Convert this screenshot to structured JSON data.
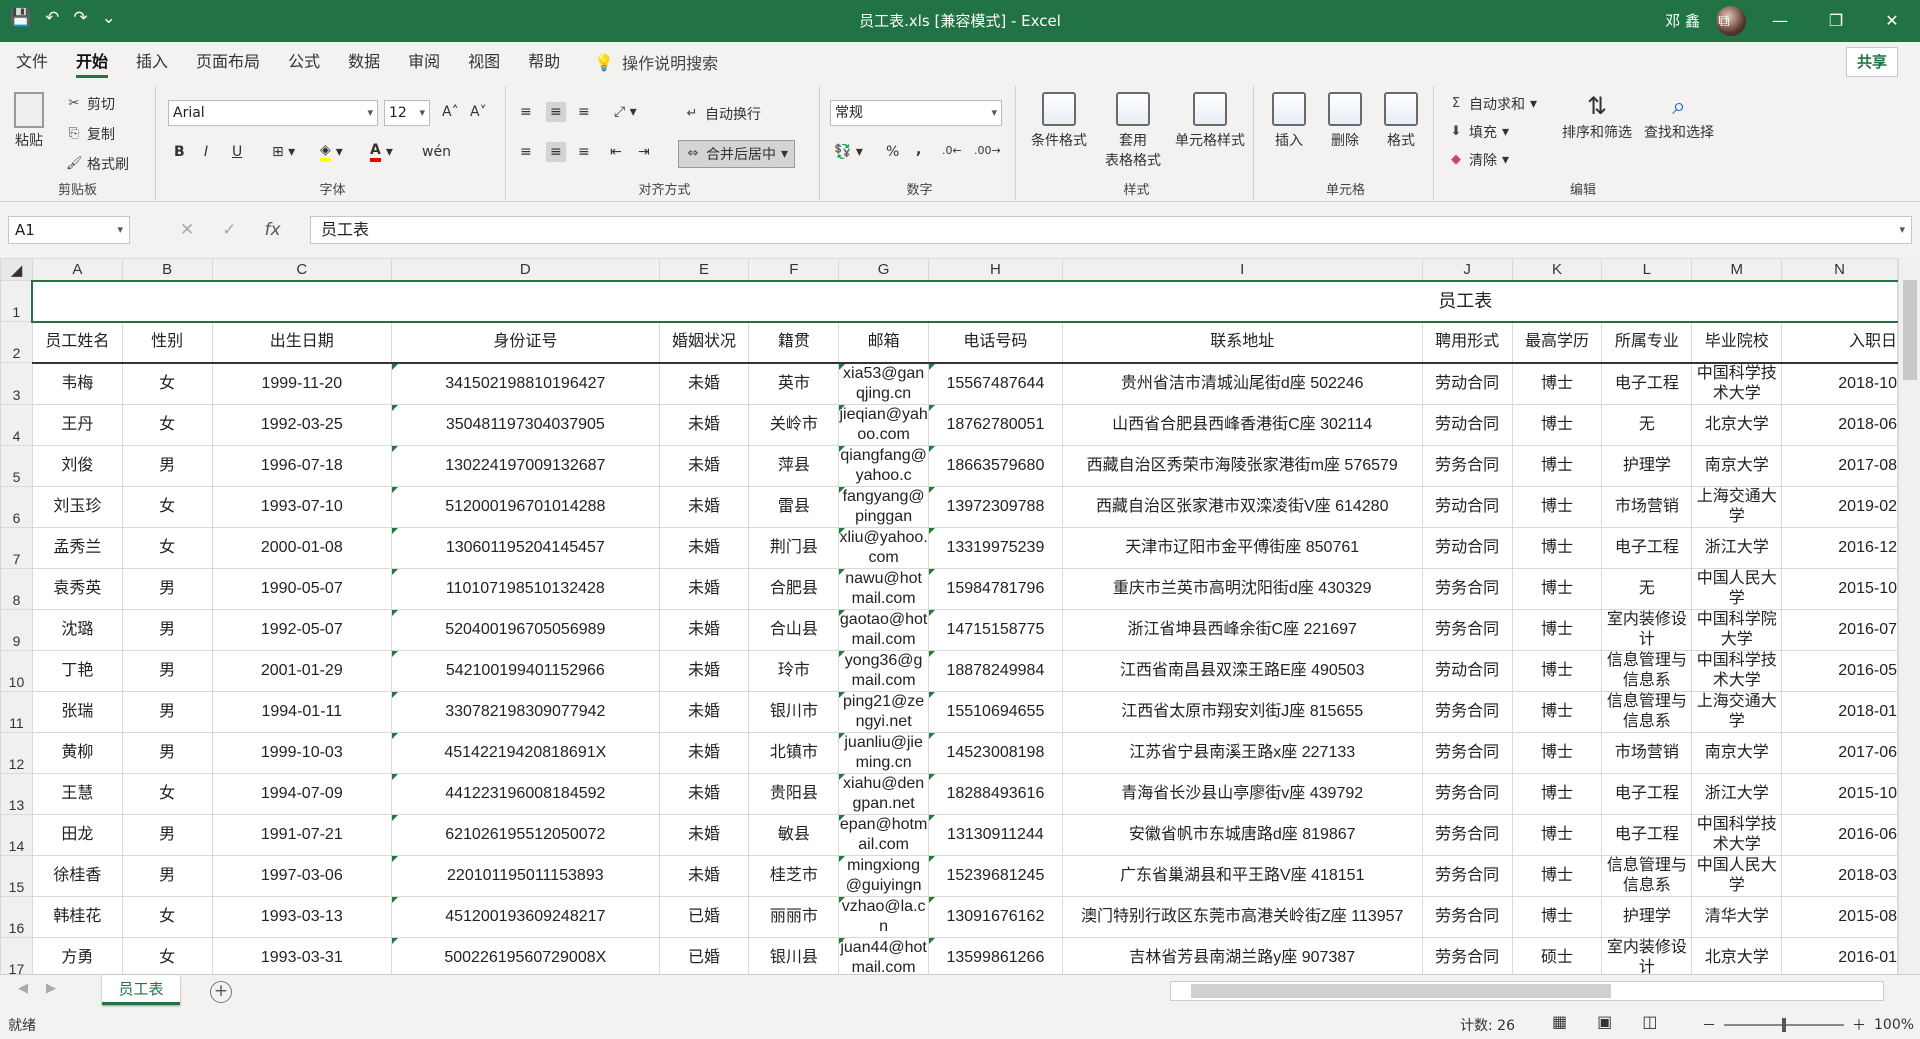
{
  "window": {
    "title": "员工表.xls  [兼容模式]  -  Excel",
    "user": "邓 鑫",
    "min": "—",
    "max": "❐",
    "close": "✕",
    "restore": "⧉"
  },
  "qat": {
    "save": "💾",
    "undo": "↶",
    "redo": "↷",
    "more": "⌄"
  },
  "menu": {
    "items": [
      "文件",
      "开始",
      "插入",
      "页面布局",
      "公式",
      "数据",
      "审阅",
      "视图",
      "帮助"
    ],
    "search": "操作说明搜索",
    "share": "共享"
  },
  "ribbon": {
    "clipboard": {
      "label": "剪贴板",
      "paste": "粘贴",
      "cut": "剪切",
      "copy": "复制",
      "format_painter": "格式刷"
    },
    "font": {
      "label": "字体",
      "name": "Arial",
      "size": "12",
      "bold": "B",
      "italic": "I",
      "underline": "U",
      "grow": "A˄",
      "shrink": "A˅",
      "wen": "wén"
    },
    "align": {
      "label": "对齐方式",
      "wrap": "自动换行",
      "merge": "合并后居中"
    },
    "number": {
      "label": "数字",
      "format": "常规",
      "percent": "%",
      "comma": ","
    },
    "styles": {
      "label": "样式",
      "cond": "条件格式",
      "table1": "套用",
      "table2": "表格格式",
      "cell": "单元格样式"
    },
    "cells": {
      "label": "单元格",
      "insert": "插入",
      "delete": "删除",
      "format": "格式"
    },
    "edit": {
      "label": "编辑",
      "autosum": "自动求和",
      "fill": "填充",
      "clear": "清除",
      "sort": "排序和筛选",
      "find": "查找和选择"
    }
  },
  "formula_bar": {
    "cell_ref": "A1",
    "cancel": "✕",
    "enter": "✓",
    "fx": "fx",
    "content": "员工表"
  },
  "sheet": {
    "col_letters": [
      "A",
      "B",
      "C",
      "D",
      "E",
      "F",
      "G",
      "H",
      "I",
      "J",
      "K",
      "L",
      "M",
      "N"
    ],
    "title": "员工表",
    "headers": [
      "员工姓名",
      "性别",
      "出生日期",
      "身份证号",
      "婚姻状况",
      "籍贯",
      "邮箱",
      "电话号码",
      "联系地址",
      "聘用形式",
      "最高学历",
      "所属专业",
      "毕业院校",
      "入职日"
    ],
    "rows": [
      {
        "n": "3",
        "c": [
          "韦梅",
          "女",
          "1999-11-20",
          "341502198810196427",
          "未婚",
          "英市",
          "xia53@ganqjing.cn",
          "15567487644",
          "贵州省洁市清城汕尾街d座 502246",
          "劳动合同",
          "博士",
          "电子工程",
          "中国科学技术大学",
          "2018-10"
        ]
      },
      {
        "n": "4",
        "c": [
          "王丹",
          "女",
          "1992-03-25",
          "350481197304037905",
          "未婚",
          "关岭市",
          "jieqian@yahoo.com",
          "18762780051",
          "山西省合肥县西峰香港街C座 302114",
          "劳动合同",
          "博士",
          "无",
          "北京大学",
          "2018-06"
        ]
      },
      {
        "n": "5",
        "c": [
          "刘俊",
          "男",
          "1996-07-18",
          "130224197009132687",
          "未婚",
          "萍县",
          "qiangfang@yahoo.c",
          "18663579680",
          "西藏自治区秀荣市海陵张家港街m座 576579",
          "劳务合同",
          "博士",
          "护理学",
          "南京大学",
          "2017-08"
        ]
      },
      {
        "n": "6",
        "c": [
          "刘玉珍",
          "女",
          "1993-07-10",
          "512000196701014288",
          "未婚",
          "雷县",
          "fangyang@pinggan",
          "13972309788",
          "西藏自治区张家港市双滦凌街V座 614280",
          "劳动合同",
          "博士",
          "市场营销",
          "上海交通大学",
          "2019-02"
        ]
      },
      {
        "n": "7",
        "c": [
          "孟秀兰",
          "女",
          "2000-01-08",
          "130601195204145457",
          "未婚",
          "荆门县",
          "xliu@yahoo.com",
          "13319975239",
          "天津市辽阳市金平傅街座 850761",
          "劳动合同",
          "博士",
          "电子工程",
          "浙江大学",
          "2016-12"
        ]
      },
      {
        "n": "8",
        "c": [
          "袁秀英",
          "男",
          "1990-05-07",
          "110107198510132428",
          "未婚",
          "合肥县",
          "nawu@hotmail.com",
          "15984781796",
          "重庆市兰英市高明沈阳街d座 430329",
          "劳务合同",
          "博士",
          "无",
          "中国人民大学",
          "2015-10"
        ]
      },
      {
        "n": "9",
        "c": [
          "沈璐",
          "男",
          "1992-05-07",
          "520400196705056989",
          "未婚",
          "合山县",
          "gaotao@hotmail.com",
          "14715158775",
          "浙江省坤县西峰余街C座 221697",
          "劳务合同",
          "博士",
          "室内装修设计",
          "中国科学院大学",
          "2016-07"
        ]
      },
      {
        "n": "10",
        "c": [
          "丁艳",
          "男",
          "2001-01-29",
          "542100199401152966",
          "未婚",
          "玲市",
          "yong36@gmail.com",
          "18878249984",
          "江西省南昌县双滦王路E座 490503",
          "劳动合同",
          "博士",
          "信息管理与信息系",
          "中国科学技术大学",
          "2016-05"
        ]
      },
      {
        "n": "11",
        "c": [
          "张瑞",
          "男",
          "1994-01-11",
          "330782198309077942",
          "未婚",
          "银川市",
          "ping21@zengyi.net",
          "15510694655",
          "江西省太原市翔安刘街J座 815655",
          "劳务合同",
          "博士",
          "信息管理与信息系",
          "上海交通大学",
          "2018-01"
        ]
      },
      {
        "n": "12",
        "c": [
          "黄柳",
          "男",
          "1999-10-03",
          "45142219420818691X",
          "未婚",
          "北镇市",
          "juanliu@jieming.cn",
          "14523008198",
          "江苏省宁县南溪王路x座 227133",
          "劳务合同",
          "博士",
          "市场营销",
          "南京大学",
          "2017-06"
        ]
      },
      {
        "n": "13",
        "c": [
          "王慧",
          "女",
          "1994-07-09",
          "441223196008184592",
          "未婚",
          "贵阳县",
          "xiahu@dengpan.net",
          "18288493616",
          "青海省长沙县山亭廖街v座 439792",
          "劳务合同",
          "博士",
          "电子工程",
          "浙江大学",
          "2015-10"
        ]
      },
      {
        "n": "14",
        "c": [
          "田龙",
          "男",
          "1991-07-21",
          "621026195512050072",
          "未婚",
          "敏县",
          "epan@hotmail.com",
          "13130911244",
          "安徽省帆市东城唐路d座 819867",
          "劳务合同",
          "博士",
          "电子工程",
          "中国科学技术大学",
          "2016-06"
        ]
      },
      {
        "n": "15",
        "c": [
          "徐桂香",
          "男",
          "1997-03-06",
          "220101195011153893",
          "未婚",
          "桂芝市",
          "mingxiong@guiyingn",
          "15239681245",
          "广东省巢湖县和平王路V座 418151",
          "劳务合同",
          "博士",
          "信息管理与信息系",
          "中国人民大学",
          "2018-03"
        ]
      },
      {
        "n": "16",
        "c": [
          "韩桂花",
          "女",
          "1993-03-13",
          "451200193609248217",
          "已婚",
          "丽丽市",
          "vzhao@la.cn",
          "13091676162",
          "澳门特别行政区东莞市高港关岭街Z座 113957",
          "劳务合同",
          "博士",
          "护理学",
          "清华大学",
          "2015-08"
        ]
      },
      {
        "n": "17",
        "c": [
          "方勇",
          "女",
          "1993-03-31",
          "50022619560729008X",
          "已婚",
          "银川县",
          "juan44@hotmail.com",
          "13599861266",
          "吉林省芳县南湖兰路y座 907387",
          "劳务合同",
          "硕士",
          "室内装修设计",
          "北京大学",
          "2016-01"
        ]
      }
    ]
  },
  "tabs": {
    "sheet": "员工表",
    "add": "+"
  },
  "status": {
    "ready": "就绪",
    "count": "计数: 26",
    "zoom": "100%",
    "minus": "－",
    "plus": "＋"
  }
}
